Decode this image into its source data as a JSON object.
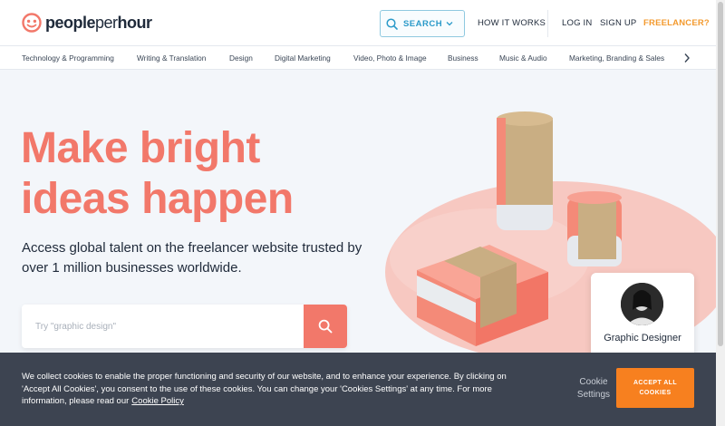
{
  "header": {
    "logo_bold": "people",
    "logo_thin": "per",
    "logo_bold2": "hour",
    "search_label": "SEARCH",
    "how_it_works": "HOW IT WORKS",
    "log_in": "LOG IN",
    "sign_up": "SIGN UP",
    "freelancer": "FREELANCER?"
  },
  "categories": [
    "Technology & Programming",
    "Writing & Translation",
    "Design",
    "Digital Marketing",
    "Video, Photo & Image",
    "Business",
    "Music & Audio",
    "Marketing, Branding & Sales"
  ],
  "hero": {
    "title_line1": "Make bright",
    "title_line2": "ideas happen",
    "subtitle": "Access global talent on the freelancer website trusted by over 1 million businesses worldwide.",
    "search_placeholder": "Try \"graphic design\""
  },
  "card": {
    "label": "Graphic Designer"
  },
  "cookie": {
    "text": "We collect cookies to enable the proper functioning and security of our website, and to enhance your experience. By clicking on 'Accept All Cookies', you consent to the use of these cookies. You can change your 'Cookies Settings' at any time. For more information, please read our",
    "policy_link": "Cookie Policy",
    "settings_line1": "Cookie",
    "settings_line2": "Settings",
    "accept_label": "ACCEPT ALL COOKIES"
  },
  "colors": {
    "brand_coral": "#f2786a",
    "accent_orange": "#f7801f",
    "search_blue": "#2b9ac9"
  },
  "icons": [
    "logo-icon",
    "search-icon",
    "chevron-down-icon",
    "chevron-right-icon"
  ]
}
